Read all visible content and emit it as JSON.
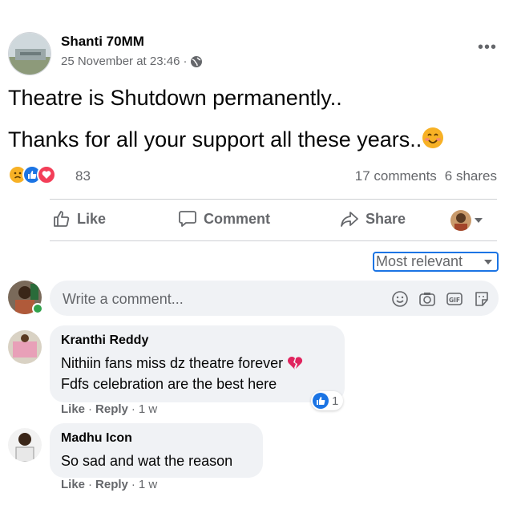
{
  "post": {
    "page_name": "Shanti 70MM",
    "timestamp": "25 November at 23:46",
    "separator": "·",
    "privacy_icon": "globe-icon",
    "more_icon": "•••",
    "text_line1": "Theatre is Shutdown permanently..",
    "text_line2": "Thanks for all your support all these years..",
    "reaction_count": "83",
    "reaction_icons": [
      "sad-icon",
      "like-icon",
      "love-icon"
    ],
    "comments_count": "17 comments",
    "shares_count": "6 shares"
  },
  "actions": {
    "like": "Like",
    "comment": "Comment",
    "share": "Share"
  },
  "sort": {
    "label": "Most relevant"
  },
  "composer": {
    "placeholder": "Write a comment...",
    "icons": [
      "emoji-icon",
      "camera-icon",
      "gif-icon",
      "sticker-icon"
    ]
  },
  "comments": [
    {
      "author": "Kranthi Reddy",
      "line1": "Nithiin fans miss dz theatre forever",
      "line2": "Fdfs celebration are the best here",
      "like": "Like",
      "reply": "Reply",
      "time": "1 w",
      "reactions": "1"
    },
    {
      "author": "Madhu Icon",
      "line1": "So sad and wat the reason",
      "like": "Like",
      "reply": "Reply",
      "time": "1 w"
    }
  ],
  "colors": {
    "accent": "#1b74e4",
    "secondary_text": "#65676b",
    "bubble": "#f0f2f5",
    "online": "#31a24c",
    "love": "#f33e58",
    "sad": "#f7b125"
  }
}
